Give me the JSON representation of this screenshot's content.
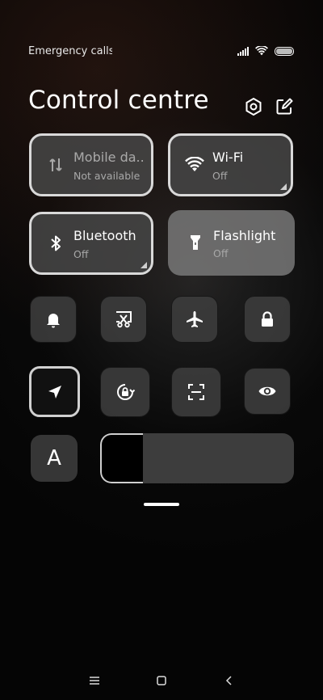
{
  "status_bar": {
    "carrier_text": "Emergency calls only",
    "icons": [
      "signal-icon",
      "wifi-icon",
      "battery-icon"
    ]
  },
  "header": {
    "title": "Control centre",
    "icons": [
      "settings-icon",
      "edit-icon"
    ]
  },
  "tiles": [
    {
      "label": "Mobile da..",
      "sub": "Not available",
      "icon": "mobile-data-icon",
      "state": "disabled"
    },
    {
      "label": "Wi-Fi",
      "sub": "Off",
      "icon": "wifi-icon",
      "state": "off"
    },
    {
      "label": "Bluetooth",
      "sub": "Off",
      "icon": "bluetooth-icon",
      "state": "off"
    },
    {
      "label": "Flashlight",
      "sub": "Off",
      "icon": "flashlight-icon",
      "state": "off"
    }
  ],
  "toggles_row1": [
    "bell-icon",
    "screenshot-icon",
    "airplane-icon",
    "lock-icon"
  ],
  "toggles_row2": [
    "location-icon",
    "auto-rotate-icon",
    "scanner-icon",
    "eye-icon"
  ],
  "font_button": "A",
  "brightness": {
    "level": 0.22
  },
  "nav": [
    "menu-icon",
    "home-icon",
    "back-icon"
  ]
}
